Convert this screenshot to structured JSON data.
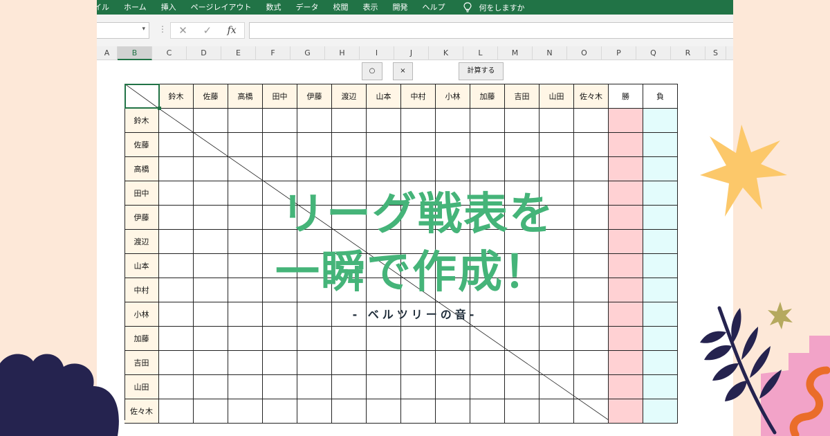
{
  "menu": {
    "items": [
      "イル",
      "ホーム",
      "挿入",
      "ページレイアウト",
      "数式",
      "データ",
      "校閲",
      "表示",
      "開発",
      "ヘルプ"
    ],
    "tell_me": "何をしますか"
  },
  "formula_bar": {
    "cancel_icon": "✕",
    "enter_icon": "✓",
    "fx_label": "fx",
    "dots": "⋮",
    "namebox_caret": "▾"
  },
  "columns": [
    "A",
    "B",
    "C",
    "D",
    "E",
    "F",
    "G",
    "H",
    "I",
    "J",
    "K",
    "L",
    "M",
    "N",
    "O",
    "P",
    "Q",
    "R",
    "S"
  ],
  "selected_column": "B",
  "buttons": {
    "circle_label": "○",
    "cross_label": "×",
    "calc_label": "計算する"
  },
  "players": [
    "鈴木",
    "佐藤",
    "高橋",
    "田中",
    "伊藤",
    "渡辺",
    "山本",
    "中村",
    "小林",
    "加藤",
    "吉田",
    "山田",
    "佐々木"
  ],
  "result_headers": {
    "win": "勝",
    "lose": "負"
  },
  "overlay": {
    "title_line_1": "リーグ戦表を",
    "title_line_2": "一瞬で作成！",
    "subtitle": "- ベルツリーの音-"
  },
  "colors": {
    "excel_green": "#217346",
    "header_fill": "#fff6e6",
    "win_fill": "#ffd1d3",
    "lose_fill": "#e3fcfc",
    "title_green": "#45b479",
    "background": "#fde8d8",
    "decor_navy": "#25234f",
    "decor_yellow": "#fcc86a",
    "decor_olive": "#b5a95e",
    "decor_pink": "#f2a3c8",
    "decor_orange": "#ea6d2a"
  }
}
